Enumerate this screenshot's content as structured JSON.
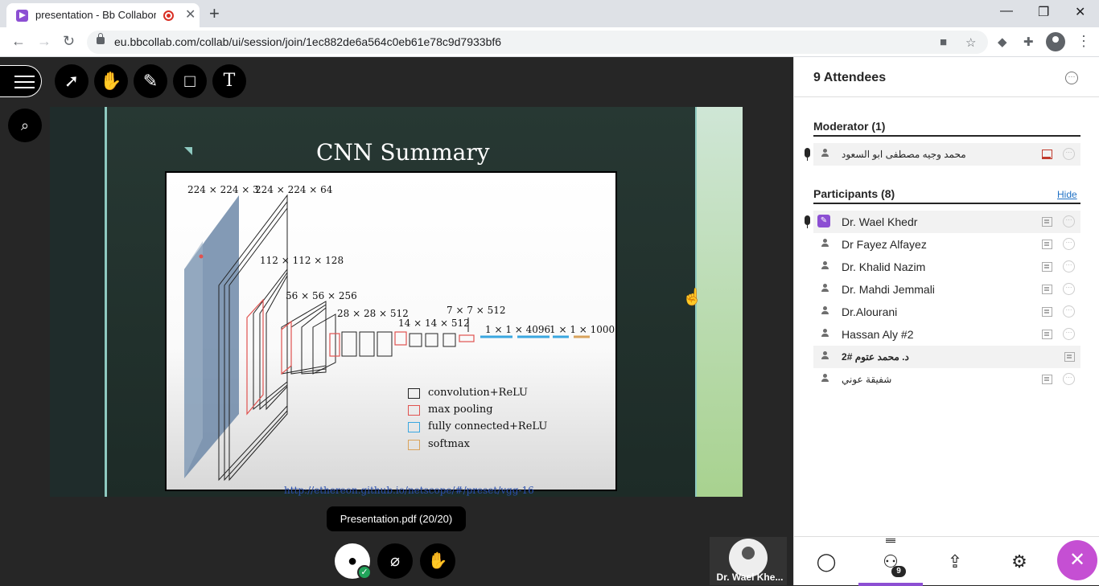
{
  "browser": {
    "tab_title": "presentation - Bb Collaborat",
    "tab_close": "✕",
    "new_tab": "+",
    "url": "eu.bbcollab.com/collab/ui/session/join/1ec882de6a564c0eb61e78c9d7933bf6"
  },
  "slide": {
    "title": "CNN Summary",
    "link": "http://ethereon.github.io/netscope/#/preset/vgg-16",
    "layer_labels": [
      "224 × 224 × 3",
      "224 × 224 × 64",
      "112 × 112 × 128",
      "56 × 56 × 256",
      "28 × 28 × 512",
      "14 × 14 × 512",
      "7 × 7 × 512",
      "1 × 1 × 4096",
      "1 × 1 × 1000"
    ],
    "legend": [
      {
        "label": "convolution+ReLU",
        "color": "#222222"
      },
      {
        "label": "max pooling",
        "color": "#e0524f"
      },
      {
        "label": "fully connected+ReLU",
        "color": "#3aa7e0"
      },
      {
        "label": "softmax",
        "color": "#d9a35c"
      }
    ]
  },
  "stage": {
    "doc_badge": "Presentation.pdf   (20/20)",
    "self_name": "Dr. Wael Khe..."
  },
  "panel": {
    "title": "9 Attendees",
    "moderator_title": "Moderator (1)",
    "moderator": "محمد وجيه مصطفى ابو السعود",
    "participants_title": "Participants (8)",
    "hide": "Hide",
    "participants": [
      "Dr. Wael Khedr",
      "Dr Fayez Alfayez",
      "Dr. Khalid Nazim",
      "Dr. Mahdi Jemmali",
      "Dr.Alourani",
      "Hassan Aly #2",
      "د. محمد عتوم #2",
      "شفيقة عوني"
    ],
    "attendee_count": "9"
  },
  "colors": {
    "accent": "#8c4fd3",
    "close": "#c54fd3"
  }
}
